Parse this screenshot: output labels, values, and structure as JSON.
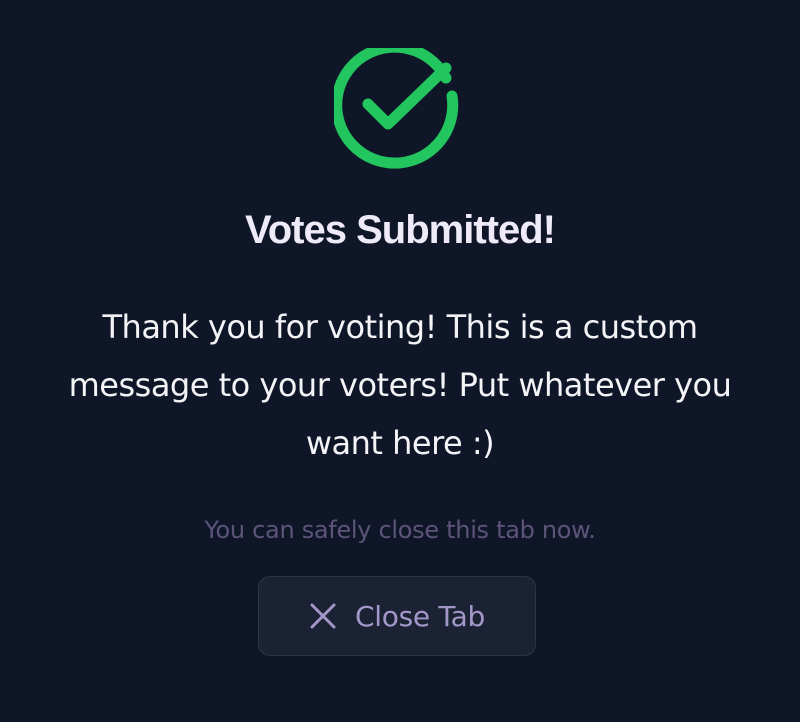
{
  "confirmation": {
    "icon": "check-circle-icon",
    "title": "Votes Submitted!",
    "message": "Thank you for voting! This is a custom message to your voters! Put whatever you want here :)",
    "hint": "You can safely close this tab now.",
    "close_button": {
      "label": "Close Tab",
      "icon": "close-icon"
    }
  },
  "colors": {
    "background": "#0e1628",
    "success": "#22c55e",
    "title": "#eeeaf8",
    "message": "#f4f4f6",
    "hint": "#5d5479",
    "button_bg": "#1a2233",
    "button_border": "#2c3446",
    "button_text": "#a397c9"
  }
}
